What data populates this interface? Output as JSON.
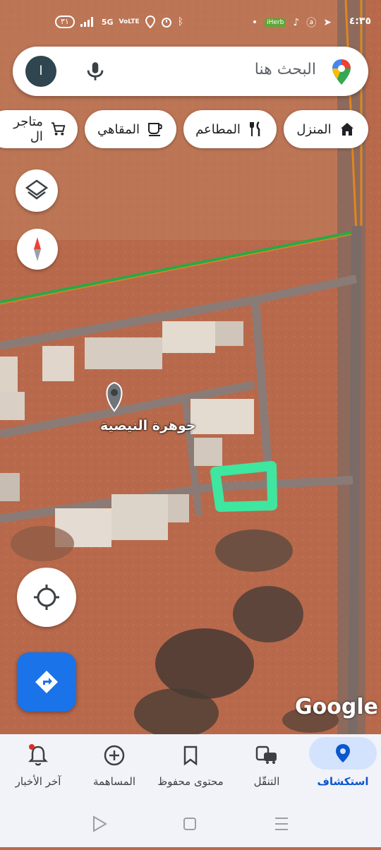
{
  "status_bar": {
    "time": "٤:٣٥",
    "battery": "٣١",
    "network": "5G",
    "volte": "VoLTE"
  },
  "search": {
    "placeholder": "البحث هنا",
    "avatar_letter": "ا"
  },
  "chips": [
    {
      "label": "المنزل",
      "icon": "home-icon"
    },
    {
      "label": "المطاعم",
      "icon": "restaurant-icon"
    },
    {
      "label": "المقاهي",
      "icon": "coffee-icon"
    },
    {
      "label": "متاجر ال",
      "icon": "cart-icon"
    }
  ],
  "map": {
    "poi_label": "جوهرة النيصية",
    "logo_text": "Google",
    "highlight_color": "#3ee6a0"
  },
  "bottom_nav": [
    {
      "label": "استكشاف",
      "icon": "explore-pin-icon",
      "active": true
    },
    {
      "label": "التنقّل",
      "icon": "commute-icon",
      "active": false
    },
    {
      "label": "محتوى محفوظ",
      "icon": "bookmark-icon",
      "active": false
    },
    {
      "label": "المساهمة",
      "icon": "add-circle-icon",
      "active": false
    },
    {
      "label": "آخر الأخبار",
      "icon": "bell-icon",
      "active": false
    }
  ],
  "colors": {
    "accent": "#1a73e8",
    "active_nav_bg": "#d3e3fd",
    "road_green": "#2aa84a",
    "road_orange": "#e0861f"
  }
}
